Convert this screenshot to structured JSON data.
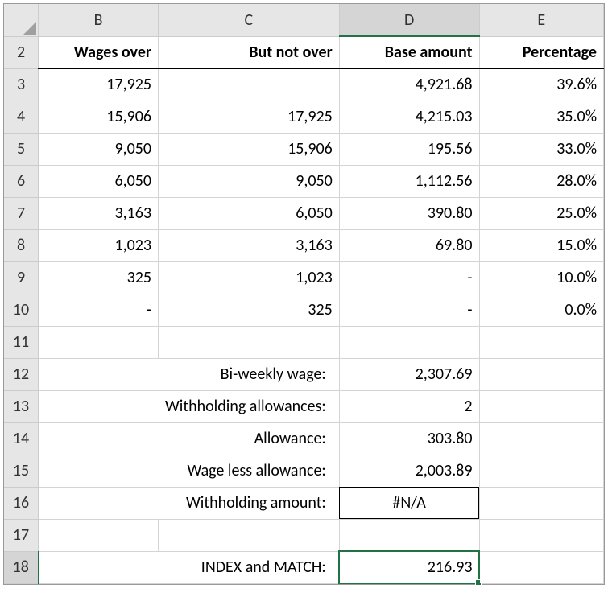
{
  "columns": [
    "B",
    "C",
    "D",
    "E"
  ],
  "rows": [
    "2",
    "3",
    "4",
    "5",
    "6",
    "7",
    "8",
    "9",
    "10",
    "11",
    "12",
    "13",
    "14",
    "15",
    "16",
    "17",
    "18"
  ],
  "active_col": "D",
  "active_row": "18",
  "headers": {
    "B": "Wages over",
    "C": "But not over",
    "D": "Base amount",
    "E": "Percentage"
  },
  "table_rows": [
    {
      "r": "3",
      "B": "17,925",
      "C": "",
      "D": "4,921.68",
      "E": "39.6%"
    },
    {
      "r": "4",
      "B": "15,906",
      "C": "17,925",
      "D": "4,215.03",
      "E": "35.0%"
    },
    {
      "r": "5",
      "B": "9,050",
      "C": "15,906",
      "D": "195.56",
      "E": "33.0%"
    },
    {
      "r": "6",
      "B": "6,050",
      "C": "9,050",
      "D": "1,112.56",
      "E": "28.0%"
    },
    {
      "r": "7",
      "B": "3,163",
      "C": "6,050",
      "D": "390.80",
      "E": "25.0%"
    },
    {
      "r": "8",
      "B": "1,023",
      "C": "3,163",
      "D": "69.80",
      "E": "15.0%"
    },
    {
      "r": "9",
      "B": "325",
      "C": "1,023",
      "D": "-",
      "E": "10.0%"
    },
    {
      "r": "10",
      "B": "-",
      "C": "325",
      "D": "-",
      "E": "0.0%"
    }
  ],
  "labels": {
    "biweekly": "Bi-weekly wage:",
    "allowances": "Withholding allowances:",
    "allowance": "Allowance:",
    "wageless": "Wage less allowance:",
    "withholding": "Withholding amount:",
    "indexmatch": "INDEX and MATCH:"
  },
  "values": {
    "biweekly": "2,307.69",
    "allowances": "2",
    "allowance": "303.80",
    "wageless": "2,003.89",
    "withholding": "#N/A",
    "indexmatch": "216.93"
  },
  "chart_data": {
    "type": "table",
    "title": "Tax withholding brackets",
    "columns": [
      "Wages over",
      "But not over",
      "Base amount",
      "Percentage"
    ],
    "rows": [
      [
        17925,
        null,
        4921.68,
        0.396
      ],
      [
        15906,
        17925,
        4215.03,
        0.35
      ],
      [
        9050,
        15906,
        195.56,
        0.33
      ],
      [
        6050,
        9050,
        1112.56,
        0.28
      ],
      [
        3163,
        6050,
        390.8,
        0.25
      ],
      [
        1023,
        3163,
        69.8,
        0.15
      ],
      [
        325,
        1023,
        0,
        0.1
      ],
      [
        0,
        325,
        0,
        0.0
      ]
    ],
    "computed": {
      "Bi-weekly wage": 2307.69,
      "Withholding allowances": 2,
      "Allowance": 303.8,
      "Wage less allowance": 2003.89,
      "Withholding amount": "#N/A",
      "INDEX and MATCH": 216.93
    }
  }
}
